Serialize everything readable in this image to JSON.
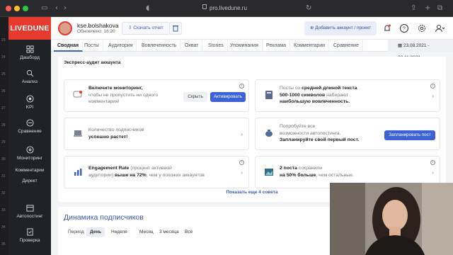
{
  "browser": {
    "url": "pro.livedune.ru"
  },
  "gutter": [
    "23",
    "24",
    "25",
    "26",
    "27",
    "28",
    "29",
    "30",
    "31",
    "32",
    "33",
    "34",
    "35"
  ],
  "sidebar": {
    "logo": "LIVEDUNE",
    "items": [
      {
        "label": "Дашборд",
        "icon": "dashboard-icon"
      },
      {
        "label": "Анализ",
        "icon": "search-icon"
      },
      {
        "label": "KPI",
        "icon": "target-icon"
      },
      {
        "label": "Сравнение",
        "icon": "compare-icon"
      },
      {
        "label": "Мониторинг",
        "icon": "monitoring-icon"
      },
      {
        "label": "Комментарии",
        "icon": "comments-icon"
      },
      {
        "label": "Директ",
        "icon": "direct-icon"
      },
      {
        "label": "Автопостинг",
        "icon": "autoposting-icon"
      },
      {
        "label": "Проверка",
        "icon": "check-icon"
      }
    ]
  },
  "topbar": {
    "account_name": "kse.bolshakova",
    "updated": "Обновлено: 16:20",
    "download_label": "Скачать отчет",
    "add_account_label": "Добавить аккаунт / проект"
  },
  "tabs": [
    "Сводная",
    "Посты",
    "Аудитория",
    "Вовлеченность",
    "Охват",
    "Stories",
    "Упоминания",
    "Реклама",
    "Комментарии",
    "Сравнение"
  ],
  "active_tab": "Сводная",
  "date_range": "23.08.2021 - 23.11.2021",
  "audit": {
    "title": "Экспресс-аудит аккаунта",
    "cards": [
      {
        "id": "monitoring",
        "line1": "Включите мониторинг,",
        "line2": "чтобы не пропустить ни одного",
        "line3": "комментария!",
        "hide_label": "Скрыть",
        "action_label": "Активировать"
      },
      {
        "id": "posts",
        "line1a": "Посты со ",
        "line1b": "средней длиной текста",
        "line2": "500-1000 символов",
        "line2b": " набирают",
        "line3": "наибольшую вовлеченность."
      },
      {
        "id": "subscribers",
        "line1": "Количество подписчиков",
        "line2": "успешно растет!"
      },
      {
        "id": "autoposting",
        "line1": "Попробуйте все",
        "line2": "возможности автопостинга.",
        "line3": "Запланируйте свой первый пост.",
        "action_label": "Запланировать пост"
      },
      {
        "id": "er",
        "line1a": "Engagement Rate",
        "line1b": " (процент активной",
        "line2a": "аудитории) ",
        "line2b": "выше на 72%",
        "line2c": ", чем у похожих аккаунтов"
      },
      {
        "id": "saved",
        "line1a": "2 поста",
        "line1b": " сохранили",
        "line2a": "на 50% больше",
        "line2b": ", чем остальные."
      }
    ],
    "more_label": "Показать еще 4 совета"
  },
  "dynamics": {
    "title": "Динамика подписчиков",
    "period_label": "Период",
    "periods": [
      "День",
      "Неделя",
      "Месяц",
      "3 месяца",
      "Всё"
    ],
    "active_period": "День"
  },
  "colors": {
    "brand": "#e63a2e",
    "accent": "#3c62d3",
    "sidebar": "#1f2328"
  }
}
